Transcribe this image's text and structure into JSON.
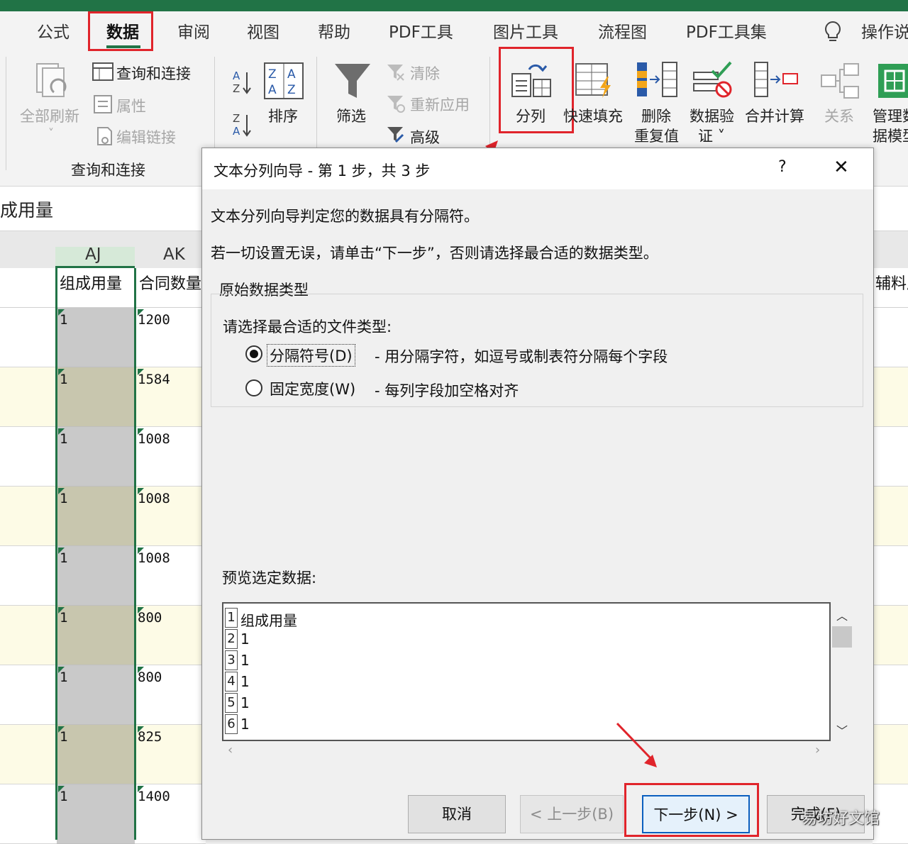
{
  "ribbon": {
    "tabs": [
      "公式",
      "数据",
      "审阅",
      "视图",
      "帮助",
      "PDF工具",
      "图片工具",
      "流程图",
      "PDF工具集",
      "操作说"
    ],
    "refresh_all": "全部刷新",
    "query_connections": "查询和连接",
    "properties": "属性",
    "edit_links": "编辑链接",
    "group_query": "查询和连接",
    "sort": "排序",
    "filter": "筛选",
    "clear": "清除",
    "reapply": "重新应用",
    "advanced": "高级",
    "text_to_columns": "分列",
    "flash_fill": "快速填充",
    "remove_dup_1": "删除",
    "remove_dup_2": "重复值",
    "data_validation_1": "数据验",
    "data_validation_2": "证 ˅",
    "consolidate": "合并计算",
    "relationships": "关系",
    "manage_model_1": "管理数",
    "manage_model_2": "据模型",
    "accent": "#217346",
    "highlight": "#e0242b"
  },
  "sheet": {
    "formula_bar_text": "成用量",
    "columns": [
      "AJ",
      "AK"
    ],
    "headers": [
      "组成用量",
      "合同数量"
    ],
    "right_header": "辅料成",
    "aj_values": [
      "1",
      "1",
      "1",
      "1",
      "1",
      "1",
      "1",
      "1",
      "1"
    ],
    "ak_values": [
      "1200",
      "1584",
      "1008",
      "1008",
      "1008",
      "800",
      "800",
      "825",
      "1400"
    ]
  },
  "dialog": {
    "title": "文本分列向导 - 第 1 步，共 3 步",
    "help": "?",
    "close": "✕",
    "line1": "文本分列向导判定您的数据具有分隔符。",
    "line2": "若一切设置无误，请单击“下一步”，否则请选择最合适的数据类型。",
    "group_title": "原始数据类型",
    "choose_label": "请选择最合适的文件类型:",
    "option1_label": "分隔符号(D)",
    "option1_desc": "- 用分隔字符，如逗号或制表符分隔每个字段",
    "option2_label": "固定宽度(W)",
    "option2_desc": "- 每列字段加空格对齐",
    "selected_option": "分隔符号(D)",
    "preview_label": "预览选定数据:",
    "preview_rows": [
      {
        "n": "1",
        "v": "组成用量"
      },
      {
        "n": "2",
        "v": "1"
      },
      {
        "n": "3",
        "v": "1"
      },
      {
        "n": "4",
        "v": "1"
      },
      {
        "n": "5",
        "v": "1"
      },
      {
        "n": "6",
        "v": "1"
      }
    ],
    "btn_cancel": "取消",
    "btn_back": "< 上一步(B)",
    "btn_next": "下一步(N) >",
    "btn_finish": "完成(F)"
  },
  "watermark": "易坊好文馆"
}
